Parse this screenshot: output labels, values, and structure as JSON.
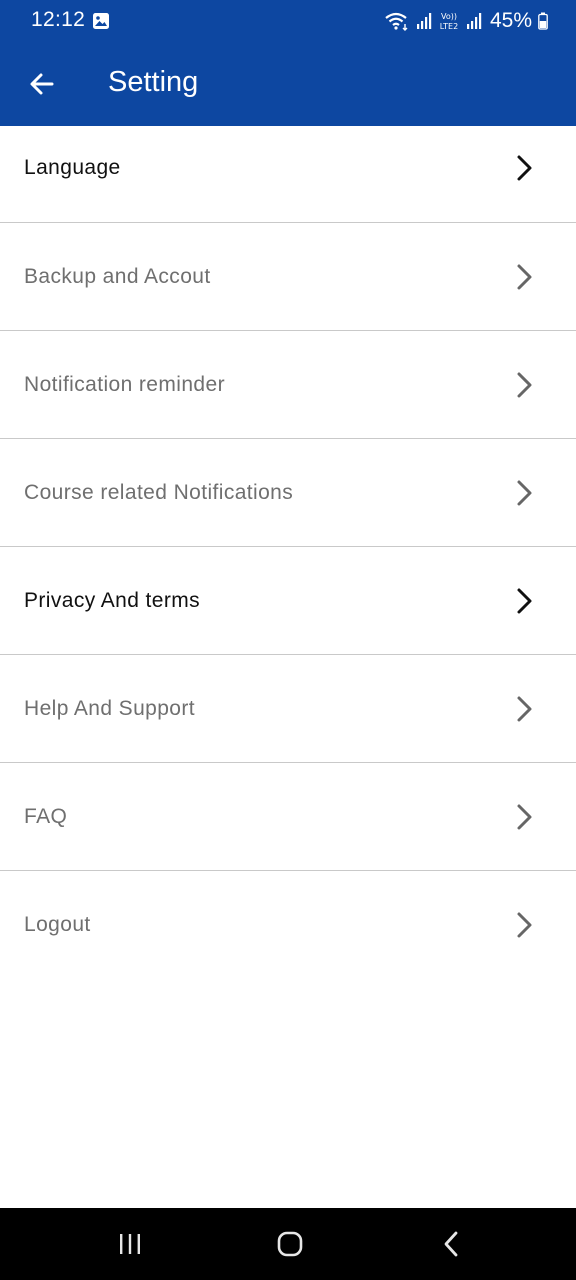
{
  "status_bar": {
    "time": "12:12",
    "battery": "45%",
    "icons": [
      "image-icon",
      "wifi-icon",
      "signal-icon",
      "volte-icon",
      "signal-icon-2",
      "battery-icon"
    ]
  },
  "app_bar": {
    "title": "Setting",
    "back_icon": "arrow-left-icon"
  },
  "settings": {
    "items": [
      {
        "label": "Language",
        "active": true
      },
      {
        "label": "Backup and Accout",
        "active": false
      },
      {
        "label": "Notification reminder",
        "active": false
      },
      {
        "label": "Course related Notifications",
        "active": false
      },
      {
        "label": "Privacy And terms",
        "active": true
      },
      {
        "label": "Help And Support",
        "active": false
      },
      {
        "label": "FAQ",
        "active": false
      },
      {
        "label": "Logout",
        "active": false
      }
    ]
  },
  "nav_bar": {
    "icons": [
      "recents-icon",
      "home-icon",
      "back-icon"
    ]
  },
  "colors": {
    "primary": "#0d47a1",
    "active_text": "#111111",
    "inactive_text": "#6f6f6f",
    "divider": "#c9c9c9"
  }
}
